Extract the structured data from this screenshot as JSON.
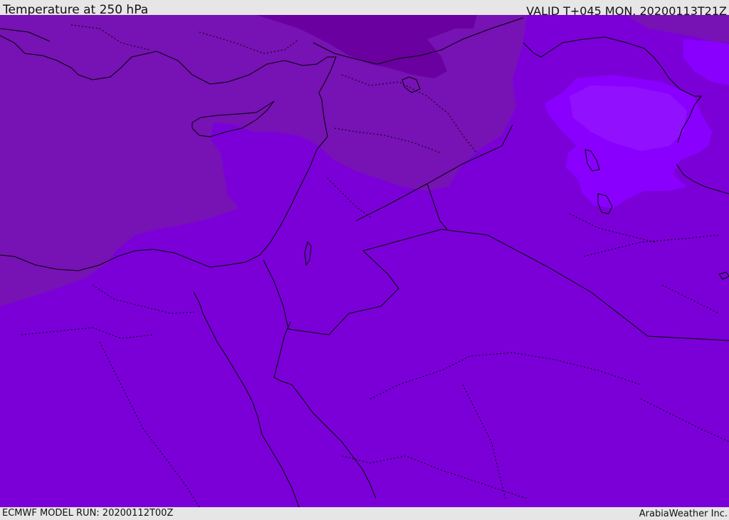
{
  "header": {
    "title": "Temperature at 250 hPa",
    "valid": "VALID T+045 MON. 20200113T21Z"
  },
  "footer": {
    "model_run": "ECMWF MODEL RUN: 20200112T00Z",
    "credit": "ArabiaWeather Inc."
  },
  "map": {
    "colors": {
      "base": "#7b00d8",
      "cooler": "#7712b4",
      "coldest": "#6a009f",
      "warm_patch": "#8a00ff",
      "warm_patch_core": "#9111ff",
      "border": "#000000"
    }
  }
}
